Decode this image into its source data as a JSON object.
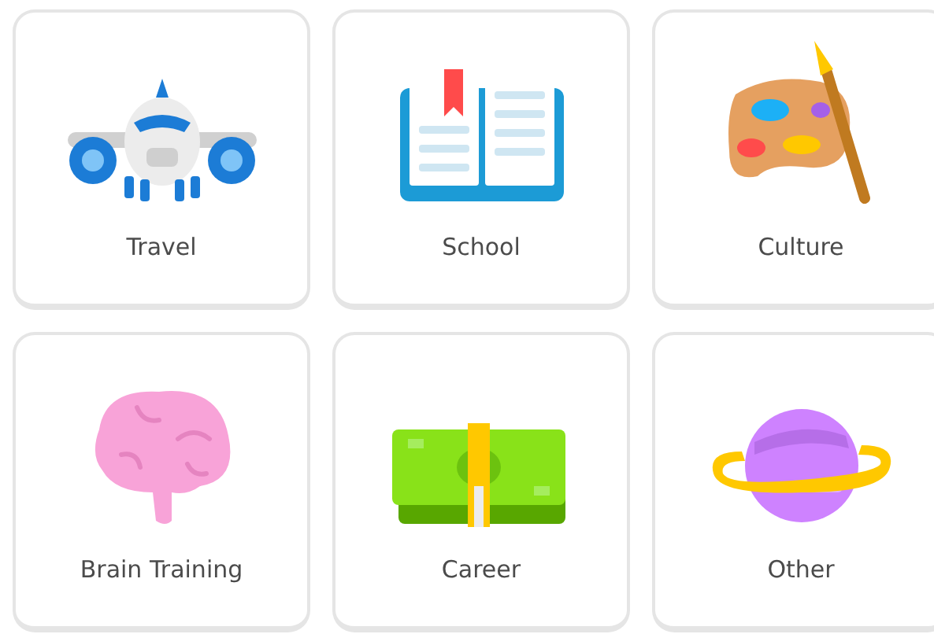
{
  "cards": [
    {
      "label": "Travel",
      "kind": "airplane"
    },
    {
      "label": "School",
      "kind": "book"
    },
    {
      "label": "Culture",
      "kind": "palette"
    },
    {
      "label": "Brain Training",
      "kind": "brain"
    },
    {
      "label": "Career",
      "kind": "money"
    },
    {
      "label": "Other",
      "kind": "planet"
    }
  ]
}
